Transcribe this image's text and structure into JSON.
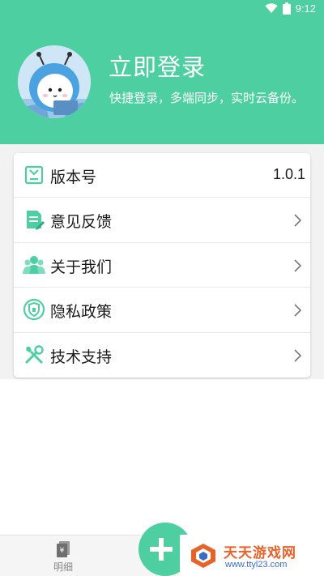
{
  "status_bar": {
    "time": "9:12"
  },
  "header": {
    "login_title": "立即登录",
    "login_subtitle": "快捷登录，多端同步，实时云备份。",
    "colors": {
      "brand": "#4ecfa2"
    }
  },
  "menu": {
    "items": [
      {
        "label": "版本号",
        "value": "1.0.1",
        "icon": "version-icon"
      },
      {
        "label": "意见反馈",
        "icon": "feedback-icon"
      },
      {
        "label": "关于我们",
        "icon": "about-us-icon"
      },
      {
        "label": "隐私政策",
        "icon": "privacy-shield-icon"
      },
      {
        "label": "技术支持",
        "icon": "tools-icon"
      }
    ]
  },
  "tab_bar": {
    "detail_label": "明细",
    "detail_icon_glyph": "¥"
  },
  "watermark": {
    "title": "天天游戏网",
    "url": "www.ttyl23.com"
  }
}
